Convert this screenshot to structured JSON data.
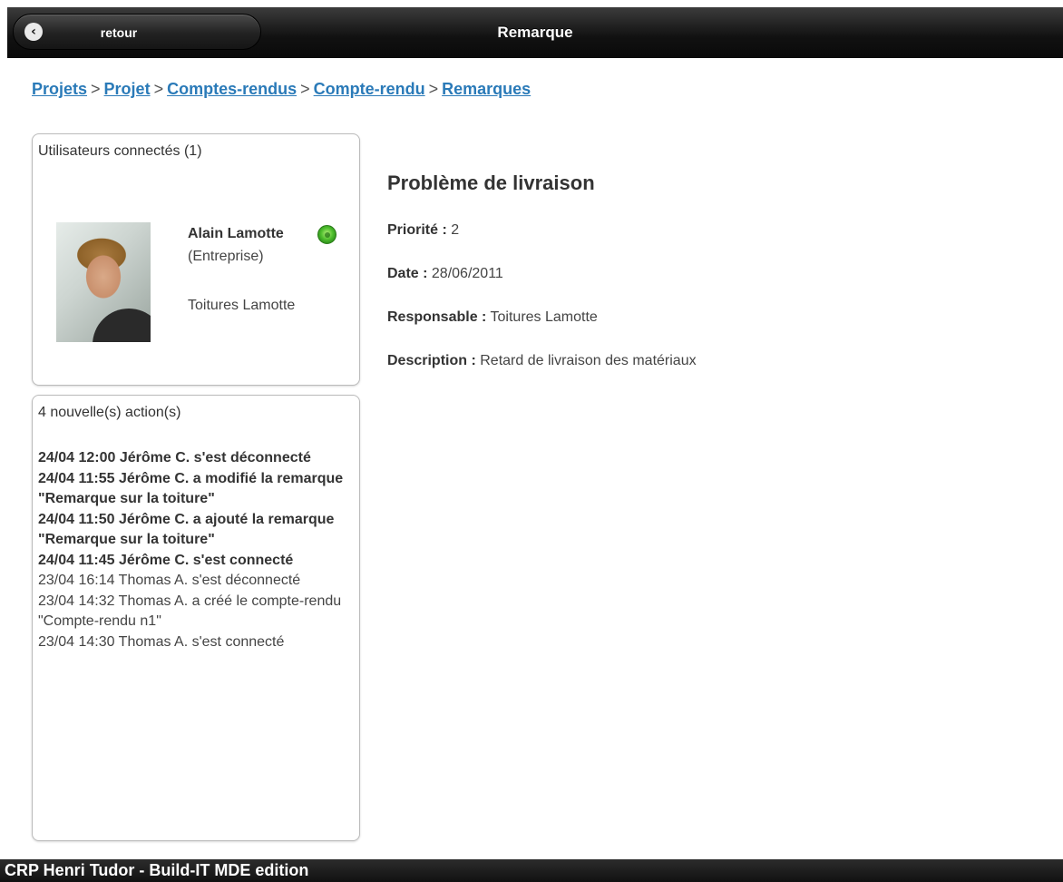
{
  "header": {
    "back_label": "retour",
    "title": "Remarque"
  },
  "breadcrumb": [
    {
      "label": "Projets"
    },
    {
      "label": "Projet"
    },
    {
      "label": "Comptes-rendus"
    },
    {
      "label": "Compte-rendu"
    },
    {
      "label": "Remarques"
    }
  ],
  "users_panel": {
    "title": "Utilisateurs connectés (1)",
    "user": {
      "name": "Alain Lamotte",
      "role": "(Entreprise)",
      "company": "Toitures Lamotte",
      "status": "online",
      "status_color": "#4fbf2e"
    }
  },
  "actions_panel": {
    "title": "4 nouvelle(s) action(s)",
    "new_items": [
      "24/04 12:00 Jérôme C. s'est déconnecté",
      "24/04 11:55 Jérôme C. a modifié la remarque \"Remarque sur la toiture\"",
      "24/04 11:50 Jérôme C. a ajouté la remarque \"Remarque sur la toiture\"",
      "24/04 11:45 Jérôme C. s'est connecté"
    ],
    "old_items": [
      "23/04 16:14 Thomas A. s'est déconnecté",
      "23/04 14:32 Thomas A. a créé le compte-rendu \"Compte-rendu n1\"",
      "23/04 14:30 Thomas A. s'est connecté"
    ]
  },
  "remark": {
    "title": "Problème de livraison",
    "priority_label": "Priorité :",
    "priority_value": "2",
    "date_label": "Date :",
    "date_value": "28/06/2011",
    "responsible_label": "Responsable :",
    "responsible_value": "Toitures Lamotte",
    "description_label": "Description :",
    "description_value": "Retard de livraison des matériaux"
  },
  "footer": {
    "text": "CRP Henri Tudor - Build-IT MDE edition"
  },
  "colors": {
    "link": "#2a7ab8",
    "header_bg": "#111111",
    "online": "#4fbf2e"
  }
}
